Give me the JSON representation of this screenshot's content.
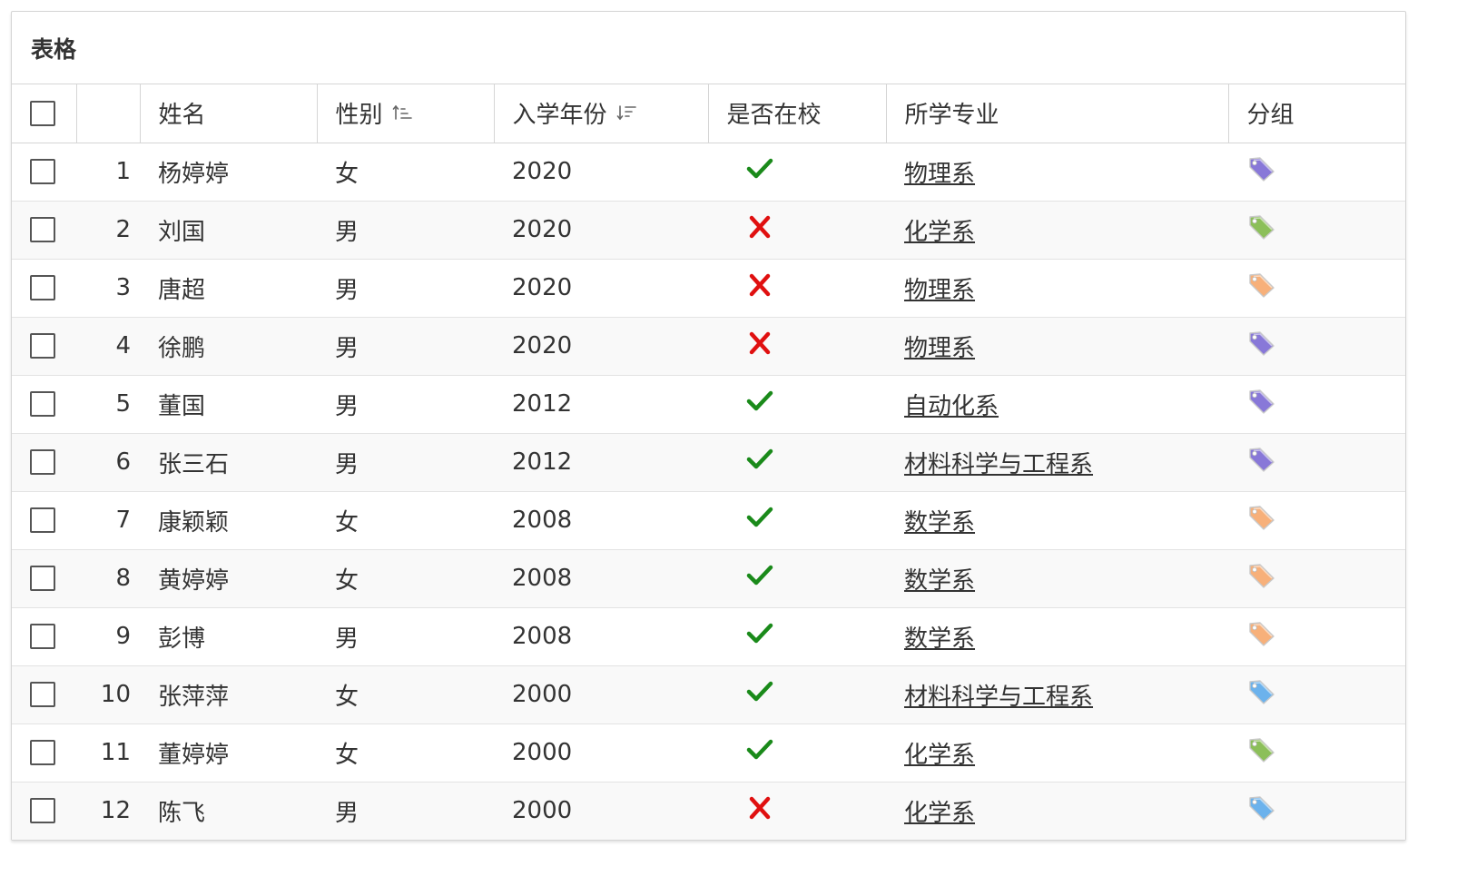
{
  "panel": {
    "title": "表格"
  },
  "columns": {
    "name": "姓名",
    "gender": "性别",
    "year": "入学年份",
    "in_school": "是否在校",
    "major": "所学专业",
    "group": "分组"
  },
  "colors": {
    "check": "#1a8a1a",
    "cross": "#e01010",
    "tag_purple": "#8878d8",
    "tag_green": "#8cbf5a",
    "tag_orange": "#f7b07a",
    "tag_blue": "#6cb2ec"
  },
  "rows": [
    {
      "index": "1",
      "name": "杨婷婷",
      "gender": "女",
      "year": "2020",
      "in_school": true,
      "major": "物理系",
      "group_color": "purple"
    },
    {
      "index": "2",
      "name": "刘国",
      "gender": "男",
      "year": "2020",
      "in_school": false,
      "major": "化学系",
      "group_color": "green"
    },
    {
      "index": "3",
      "name": "唐超",
      "gender": "男",
      "year": "2020",
      "in_school": false,
      "major": "物理系",
      "group_color": "orange"
    },
    {
      "index": "4",
      "name": "徐鹏",
      "gender": "男",
      "year": "2020",
      "in_school": false,
      "major": "物理系",
      "group_color": "purple"
    },
    {
      "index": "5",
      "name": "董国",
      "gender": "男",
      "year": "2012",
      "in_school": true,
      "major": "自动化系",
      "group_color": "purple"
    },
    {
      "index": "6",
      "name": "张三石",
      "gender": "男",
      "year": "2012",
      "in_school": true,
      "major": "材料科学与工程系",
      "group_color": "purple"
    },
    {
      "index": "7",
      "name": "康颖颖",
      "gender": "女",
      "year": "2008",
      "in_school": true,
      "major": "数学系",
      "group_color": "orange"
    },
    {
      "index": "8",
      "name": "黄婷婷",
      "gender": "女",
      "year": "2008",
      "in_school": true,
      "major": "数学系",
      "group_color": "orange"
    },
    {
      "index": "9",
      "name": "彭博",
      "gender": "男",
      "year": "2008",
      "in_school": true,
      "major": "数学系",
      "group_color": "orange"
    },
    {
      "index": "10",
      "name": "张萍萍",
      "gender": "女",
      "year": "2000",
      "in_school": true,
      "major": "材料科学与工程系",
      "group_color": "blue"
    },
    {
      "index": "11",
      "name": "董婷婷",
      "gender": "女",
      "year": "2000",
      "in_school": true,
      "major": "化学系",
      "group_color": "green"
    },
    {
      "index": "12",
      "name": "陈飞",
      "gender": "男",
      "year": "2000",
      "in_school": false,
      "major": "化学系",
      "group_color": "blue"
    }
  ]
}
